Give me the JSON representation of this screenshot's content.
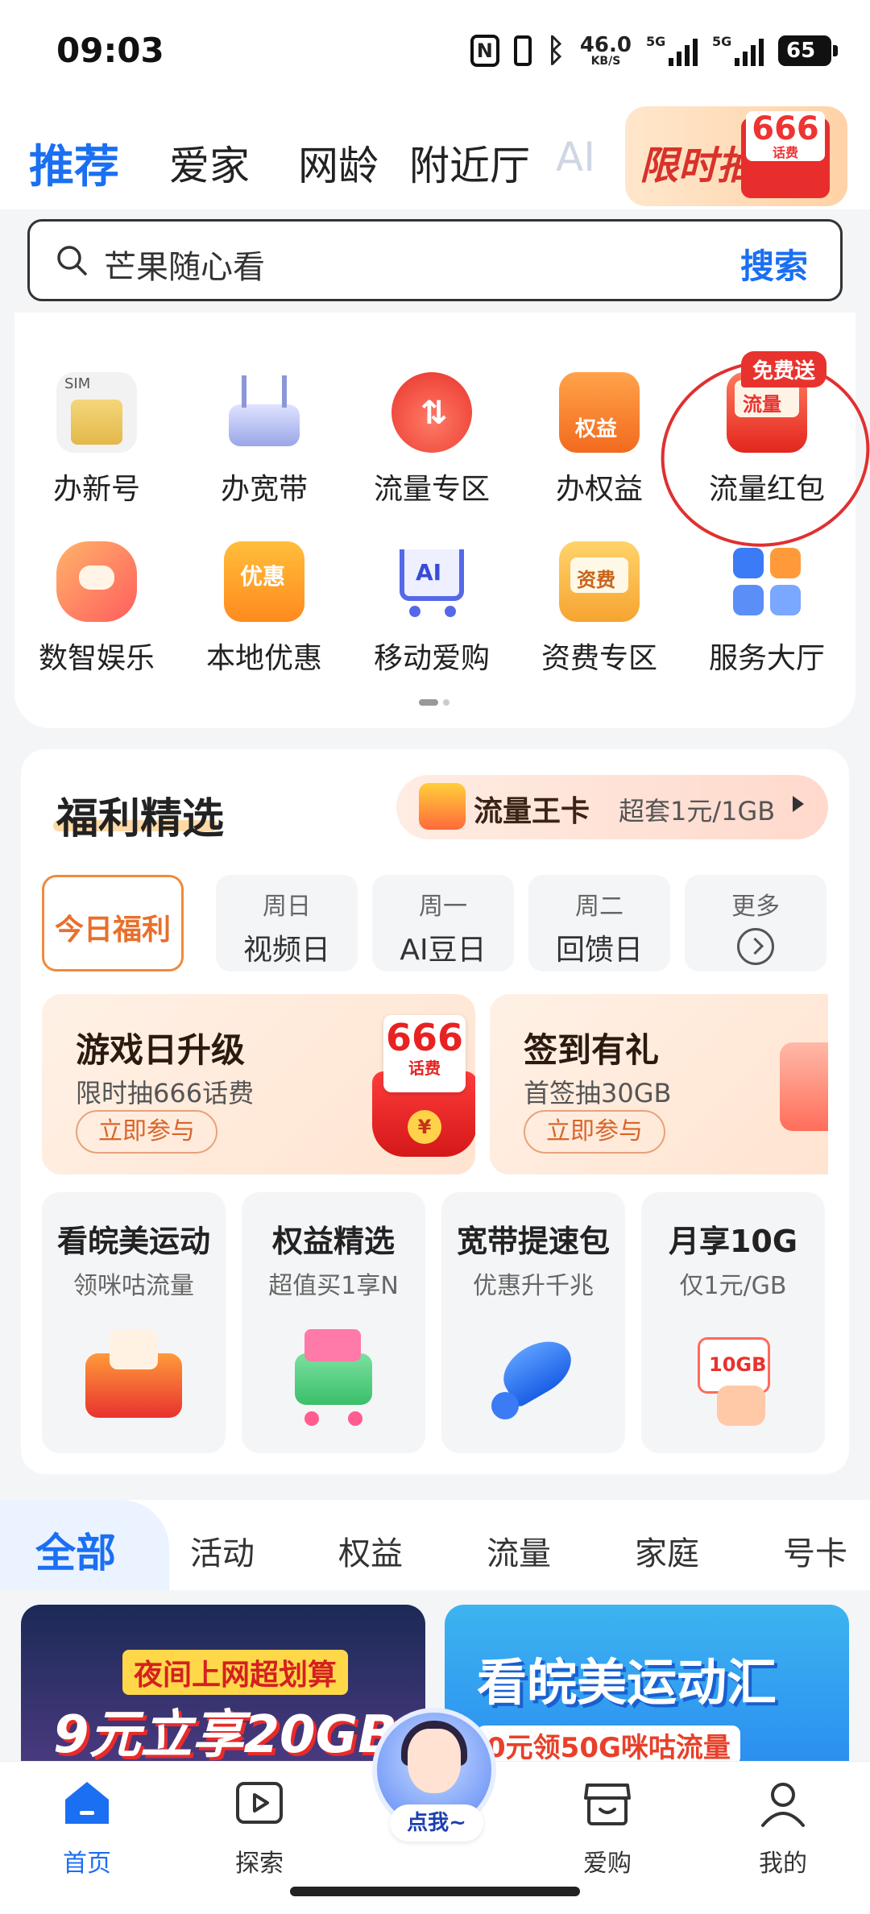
{
  "status_bar": {
    "time": "09:03",
    "speed": "46.0",
    "speed_unit": "KB/S",
    "network_1": "5G",
    "network_2": "5G",
    "battery": "65"
  },
  "top_tabs": [
    {
      "label": "推荐"
    },
    {
      "label": "爱家"
    },
    {
      "label": "网龄"
    },
    {
      "label": "附近厅"
    },
    {
      "label": "AI"
    }
  ],
  "top_promo": {
    "text": "限时抽",
    "amount": "666",
    "unit": "话费",
    "coin": "¥"
  },
  "search": {
    "text": "芒果随心看",
    "button": "搜索"
  },
  "services": [
    {
      "label": "办新号",
      "icon": "sim-card-icon"
    },
    {
      "label": "办宽带",
      "icon": "router-icon"
    },
    {
      "label": "流量专区",
      "icon": "data-drop-icon"
    },
    {
      "label": "办权益",
      "icon": "shop-icon",
      "icon_text": "权益"
    },
    {
      "label": "流量红包",
      "icon": "red-envelope-icon",
      "icon_text": "流量",
      "badge": "免费送"
    },
    {
      "label": "数智娱乐",
      "icon": "gamepad-icon"
    },
    {
      "label": "本地优惠",
      "icon": "coupon-icon",
      "icon_text": "优惠"
    },
    {
      "label": "移动爱购",
      "icon": "cart-icon",
      "icon_text": "AI"
    },
    {
      "label": "资费专区",
      "icon": "fee-icon",
      "icon_text": "资费"
    },
    {
      "label": "服务大厅",
      "icon": "grid-icon"
    }
  ],
  "welfare": {
    "title": "福利精选",
    "king_card": {
      "name": "流量王卡",
      "desc": "超套1元/1GB"
    },
    "day_tabs": [
      {
        "top": "",
        "bottom": "今日福利"
      },
      {
        "top": "周日",
        "bottom": "视频日"
      },
      {
        "top": "周一",
        "bottom": "AI豆日"
      },
      {
        "top": "周二",
        "bottom": "回馈日"
      },
      {
        "top": "更多",
        "bottom": ""
      }
    ],
    "promo_cards": [
      {
        "title": "游戏日升级",
        "sub": "限时抽666话费",
        "button": "立即参与",
        "amount": "666",
        "unit": "话费",
        "coin": "¥"
      },
      {
        "title": "签到有礼",
        "sub": "首签抽30GB",
        "button": "立即参与"
      }
    ],
    "mini_cards": [
      {
        "title": "看皖美运动",
        "sub": "领咪咕流量"
      },
      {
        "title": "权益精选",
        "sub": "超值买1享N"
      },
      {
        "title": "宽带提速包",
        "sub": "优惠升千兆"
      },
      {
        "title": "月享10G",
        "sub": "仅1元/GB",
        "art_text": "10GB"
      }
    ]
  },
  "category_tabs": [
    {
      "label": "全部"
    },
    {
      "label": "活动"
    },
    {
      "label": "权益"
    },
    {
      "label": "流量"
    },
    {
      "label": "家庭"
    },
    {
      "label": "号卡"
    }
  ],
  "banners": [
    {
      "line1": "夜间上网超划算",
      "line2": "9元立享20GB"
    },
    {
      "line1": "看皖美运动汇",
      "line2": "0元领50G咪咕流量"
    }
  ],
  "assistant": {
    "label": "点我~"
  },
  "bottom_nav": [
    {
      "label": "首页",
      "icon": "home-icon"
    },
    {
      "label": "探索",
      "icon": "play-icon"
    },
    {
      "label": "爱购",
      "icon": "store-icon"
    },
    {
      "label": "我的",
      "icon": "user-icon"
    }
  ],
  "colors": {
    "primary": "#1a6ff2",
    "accent_orange": "#e8702c",
    "red": "#e03030"
  }
}
